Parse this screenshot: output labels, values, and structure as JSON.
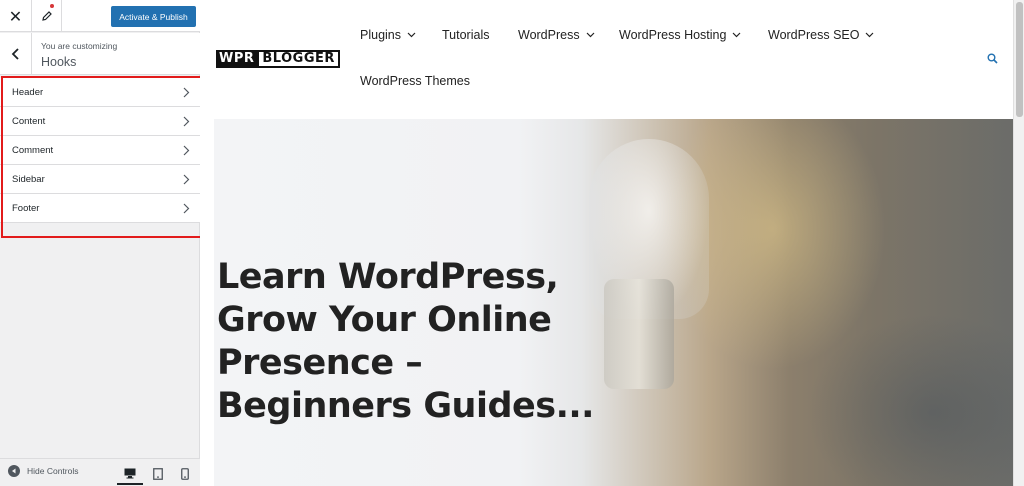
{
  "customizer": {
    "publish_label": "Activate & Publish",
    "subtitle": "You are customizing",
    "title": "Hooks",
    "sections": [
      "Header",
      "Content",
      "Comment",
      "Sidebar",
      "Footer"
    ],
    "hide_controls_label": "Hide Controls",
    "devices": [
      "desktop-icon",
      "tablet-icon",
      "mobile-icon"
    ],
    "active_device": "desktop",
    "publish_color": "#2271b1",
    "highlight_color": "#e21b1b"
  },
  "site": {
    "logo_part1": "WPR",
    "logo_part2": "BLOGGER",
    "nav": {
      "plugins": "Plugins",
      "tutorials": "Tutorials",
      "wordpress": "WordPress",
      "hosting": "WordPress Hosting",
      "seo": "WordPress SEO",
      "themes": "WordPress Themes"
    },
    "hero_title": "Learn WordPress, Grow Your Online Presence – Beginners Guides...",
    "search_icon": "search-icon"
  }
}
